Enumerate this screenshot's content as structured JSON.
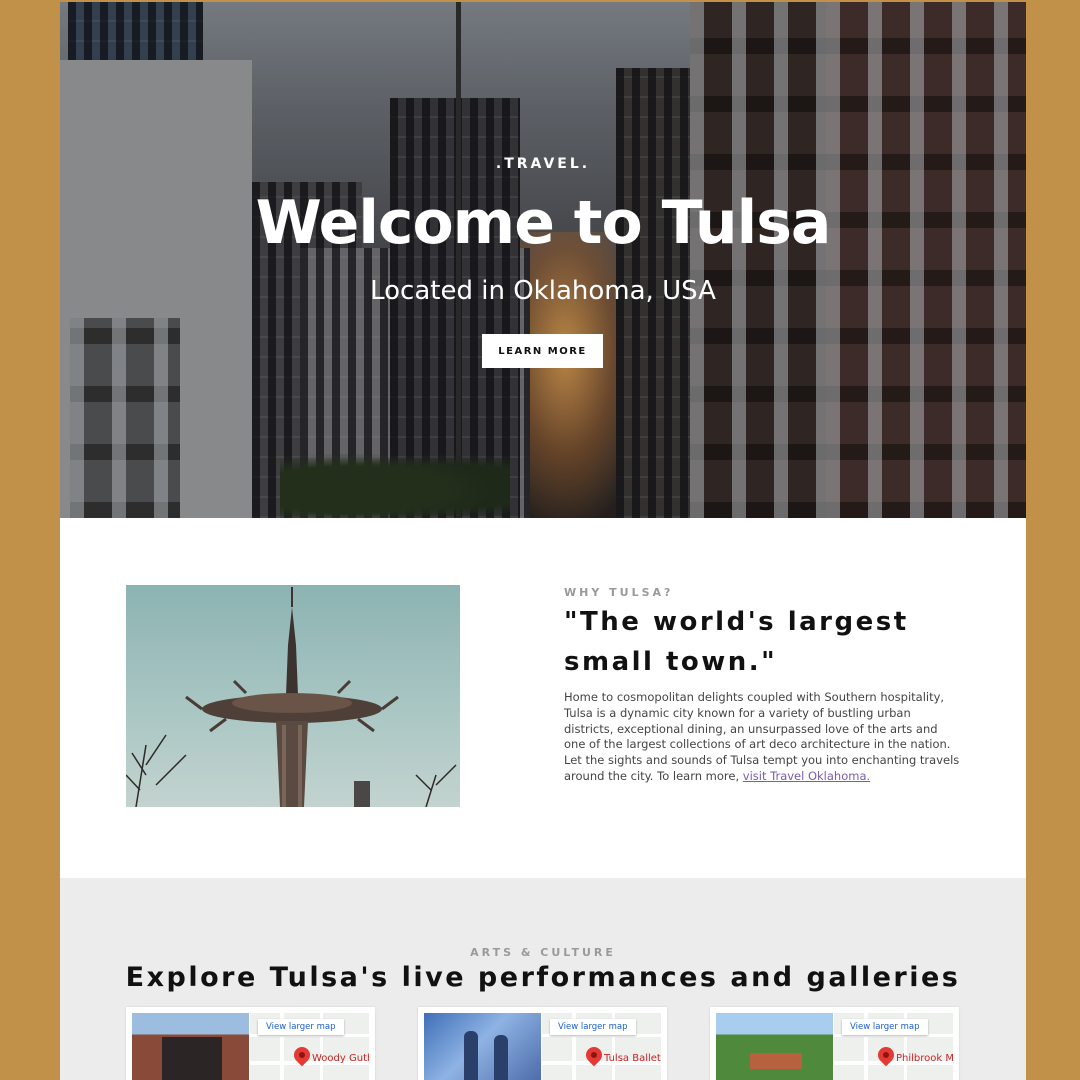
{
  "hero": {
    "eyebrow": ".TRAVEL.",
    "title": "Welcome to Tulsa",
    "subtitle": "Located in Oklahoma, USA",
    "button": "LEARN MORE"
  },
  "why": {
    "eyebrow": "WHY TULSA?",
    "title": "\"The world's largest small town.\"",
    "body": "Home to cosmopolitan delights coupled with Southern hospitality, Tulsa is a dynamic city known for a variety of bustling urban districts, exceptional dining, an unsurpassed love of the arts and one of the largest collections of art deco architecture in the nation. Let the sights and sounds of Tulsa tempt you into enchanting travels around the city. To learn more, ",
    "link": "visit Travel Oklahoma."
  },
  "arts": {
    "eyebrow": "ARTS & CULTURE",
    "title": "Explore Tulsa's live performances and galleries",
    "cards": [
      {
        "map_button": "View larger map",
        "pin_label": "Woody Guth"
      },
      {
        "map_button": "View larger map",
        "pin_label": "Tulsa Ballet"
      },
      {
        "map_button": "View larger map",
        "pin_label": "Philbrook M"
      }
    ]
  },
  "colors": {
    "page_background": "#c29149",
    "arts_background": "#ececec",
    "link": "#7a5bb0",
    "map_pin": "#e53935"
  }
}
